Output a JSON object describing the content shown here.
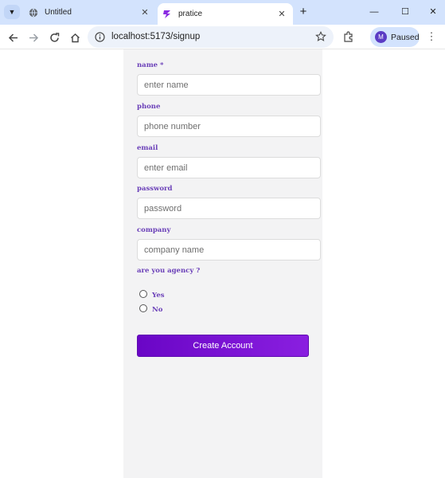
{
  "browser": {
    "tabs": [
      {
        "title": "Untitled",
        "active": false
      },
      {
        "title": "pratice",
        "active": true
      }
    ],
    "url": "localhost:5173/signup",
    "profile_label": "Paused",
    "profile_initial": "M"
  },
  "form": {
    "fields": [
      {
        "label": "name *",
        "placeholder": "enter name"
      },
      {
        "label": "phone",
        "placeholder": "phone number"
      },
      {
        "label": "email",
        "placeholder": "enter email"
      },
      {
        "label": "password",
        "placeholder": "password"
      },
      {
        "label": "company",
        "placeholder": "company name"
      }
    ],
    "agency_question": "are you agency ?",
    "agency_options": [
      "Yes",
      "No"
    ],
    "submit_label": "Create Account"
  },
  "colors": {
    "label": "#6a3fb8",
    "button": "#7a12d6",
    "card_bg": "#f3f3f4",
    "tabbar_bg": "#d3e3fd"
  }
}
